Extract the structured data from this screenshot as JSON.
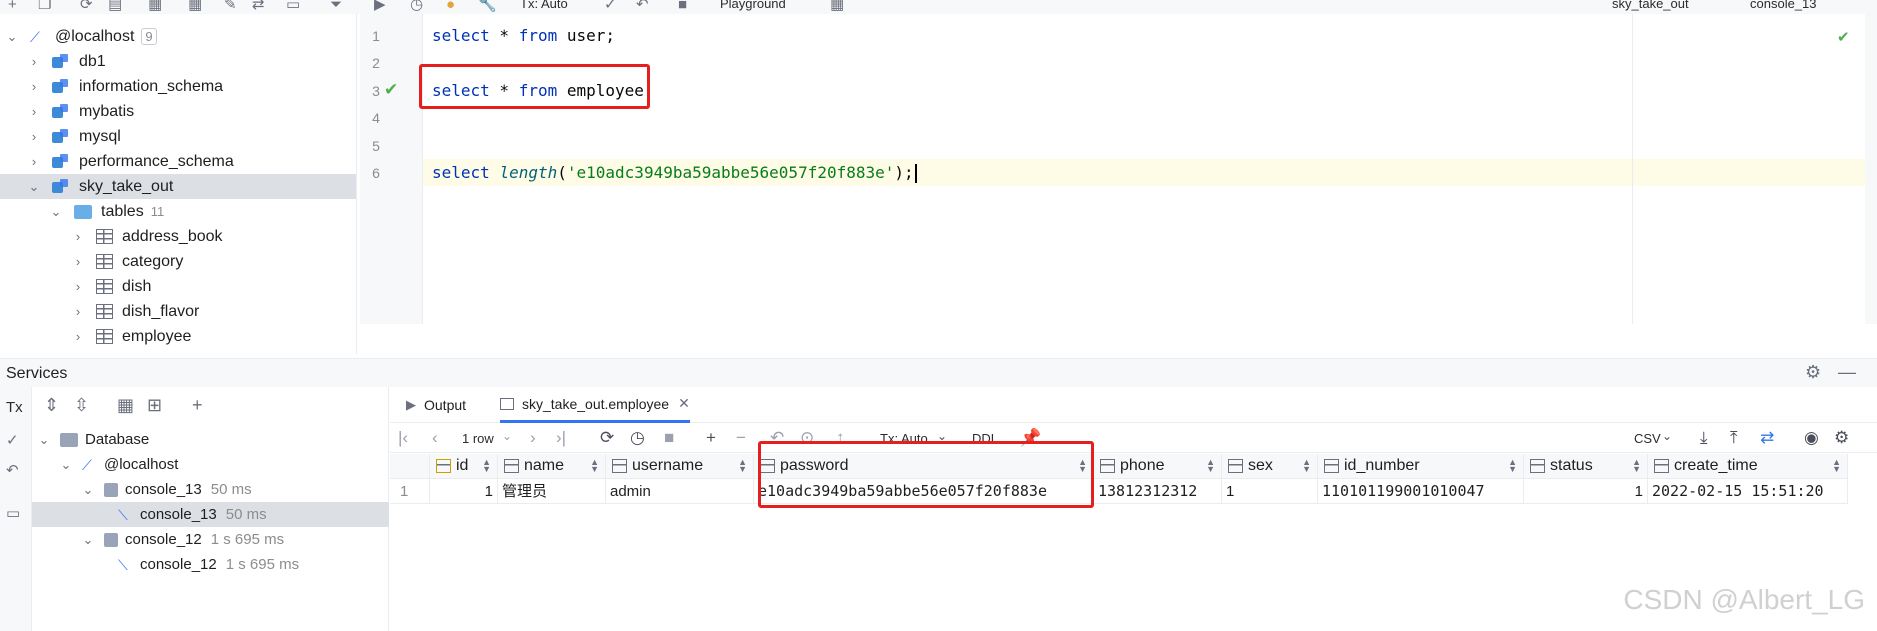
{
  "toolbar": {
    "tx_mode": "Tx: Auto",
    "playground": "Playground",
    "schema_selector": "sky_take_out",
    "console_selector": "console_13"
  },
  "db_tree": {
    "root": {
      "label": "@localhost",
      "count": "9"
    },
    "databases": [
      {
        "label": "db1"
      },
      {
        "label": "information_schema"
      },
      {
        "label": "mybatis"
      },
      {
        "label": "mysql"
      },
      {
        "label": "performance_schema"
      },
      {
        "label": "sky_take_out"
      }
    ],
    "tables_folder": {
      "label": "tables",
      "count": "11"
    },
    "tables": [
      {
        "label": "address_book"
      },
      {
        "label": "category"
      },
      {
        "label": "dish"
      },
      {
        "label": "dish_flavor"
      },
      {
        "label": "employee"
      }
    ]
  },
  "editor": {
    "lines": [
      {
        "no": "1",
        "kw1": "select",
        "rest": " * ",
        "kw2": "from",
        "tail": " user;"
      },
      {
        "no": "2"
      },
      {
        "no": "3",
        "kw1": "select",
        "rest": " * ",
        "kw2": "from",
        "tail": " employee;"
      },
      {
        "no": "4"
      },
      {
        "no": "5"
      },
      {
        "no": "6",
        "kw1": "select",
        "fn": "length",
        "open": "(",
        "str": "'e10adc3949ba59abbe56e057f20f883e'",
        "close": ");"
      }
    ]
  },
  "services": {
    "title": "Services",
    "tree": [
      {
        "label": "Database"
      },
      {
        "label": "@localhost"
      },
      {
        "label": "console_13",
        "time": "50 ms"
      },
      {
        "label": "console_13",
        "time": "50 ms"
      },
      {
        "label": "console_12",
        "time": "1 s 695 ms"
      },
      {
        "label": "console_12",
        "time": "1 s 695 ms"
      }
    ]
  },
  "result": {
    "tabs": [
      {
        "label": "Output"
      },
      {
        "label": "sky_take_out.employee"
      }
    ],
    "row_count": "1 row",
    "tx_mode": "Tx: Auto",
    "ddl": "DDL",
    "export_format": "CSV",
    "columns": [
      "id",
      "name",
      "username",
      "password",
      "phone",
      "sex",
      "id_number",
      "status",
      "create_time"
    ],
    "rows": [
      {
        "row_no": "1",
        "cells": [
          "1",
          "管理员",
          "admin",
          "e10adc3949ba59abbe56e057f20f883e",
          "13812312312",
          "1",
          "110101199001010047",
          "1",
          "2022-02-15 15:51:20"
        ]
      }
    ]
  },
  "watermark": "CSDN @Albert_LG",
  "colors": {
    "highlight_box": "#e51e1e",
    "keyword": "#0033b3",
    "string": "#067d17",
    "accent": "#3574f0"
  }
}
